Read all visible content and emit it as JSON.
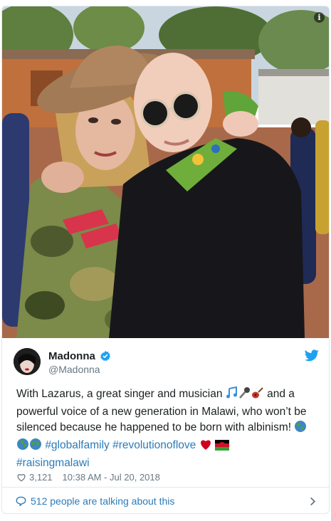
{
  "tweet": {
    "display_name": "Madonna",
    "handle": "@Madonna",
    "text_parts": [
      "With Lazarus, a great singer and musician ",
      " and a powerful voice of a new generation in Malawi, who won’t be silenced because he happened to be born with albinism! "
    ],
    "hashtags": [
      "#globalfamily",
      "#revolutionoflove",
      "#raisingmalawi"
    ],
    "likes": "3,121",
    "timestamp": "10:38 AM - Jul 20, 2018",
    "talking_about": "512 people are talking about this",
    "icons": {
      "info": "info-icon",
      "verified": "verified-badge-icon",
      "brand": "twitter-bird-icon",
      "like": "heart-icon",
      "reply": "speech-bubble-icon",
      "more": "chevron-right-icon"
    },
    "colors": {
      "link": "#2b7bb9",
      "verified": "#1da1f2",
      "brand": "#1da1f2",
      "meta": "#697882",
      "heart_emoji": "#d0021b"
    }
  }
}
